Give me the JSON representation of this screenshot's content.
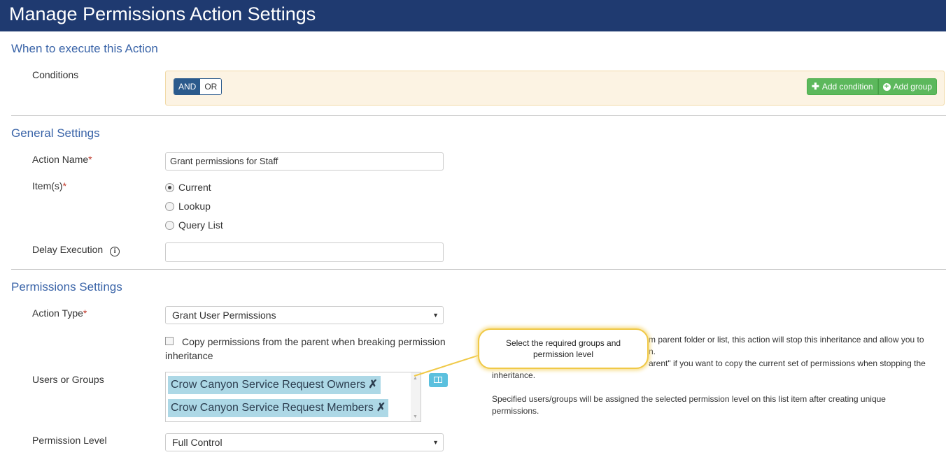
{
  "window": {
    "title": "Manage Permissions Action Settings"
  },
  "when": {
    "section_title": "When to execute this Action",
    "conditions_label": "Conditions",
    "and_label": "AND",
    "or_label": "OR",
    "add_condition_label": "Add condition",
    "add_group_label": "Add group",
    "add_condition_icon": "plus-icon",
    "add_group_icon": "plus-circle-icon"
  },
  "general": {
    "section_title": "General Settings",
    "action_name_label": "Action Name",
    "action_name_value": "Grant permissions for Staff",
    "items_label": "Item(s)",
    "items_options": [
      "Current",
      "Lookup",
      "Query List"
    ],
    "items_selected": "Current",
    "delay_label": "Delay Execution",
    "delay_value": "",
    "required_mark": "*"
  },
  "permissions": {
    "section_title": "Permissions Settings",
    "action_type_label": "Action Type",
    "action_type_value": "Grant User Permissions",
    "copy_checkbox_label": "Copy permissions from the parent when breaking permission inheritance",
    "copy_checked": false,
    "users_label": "Users or Groups",
    "users": [
      "Crow Canyon Service Request Owners",
      "Crow Canyon Service Request Members"
    ],
    "remove_glyph": "✗",
    "permission_level_label": "Permission Level",
    "permission_level_value": "Full Control",
    "help_line1": "m parent folder or list, this action will stop this inheritance and allow you to",
    "help_line2": "n.",
    "help_line3": "arent\" if you want to copy the current set of permissions when stopping the",
    "help_line4": "inheritance.",
    "help_line5": "Specified users/groups will be assigned the selected permission level on this list item after creating unique",
    "help_line6": "permissions."
  },
  "callout": {
    "text": "Select the required groups and permission level"
  },
  "colors": {
    "header": "#1f3a70",
    "section": "#3a64a8",
    "green": "#5cb85c",
    "chip": "#add8e6",
    "callout_border": "#f0c947"
  }
}
